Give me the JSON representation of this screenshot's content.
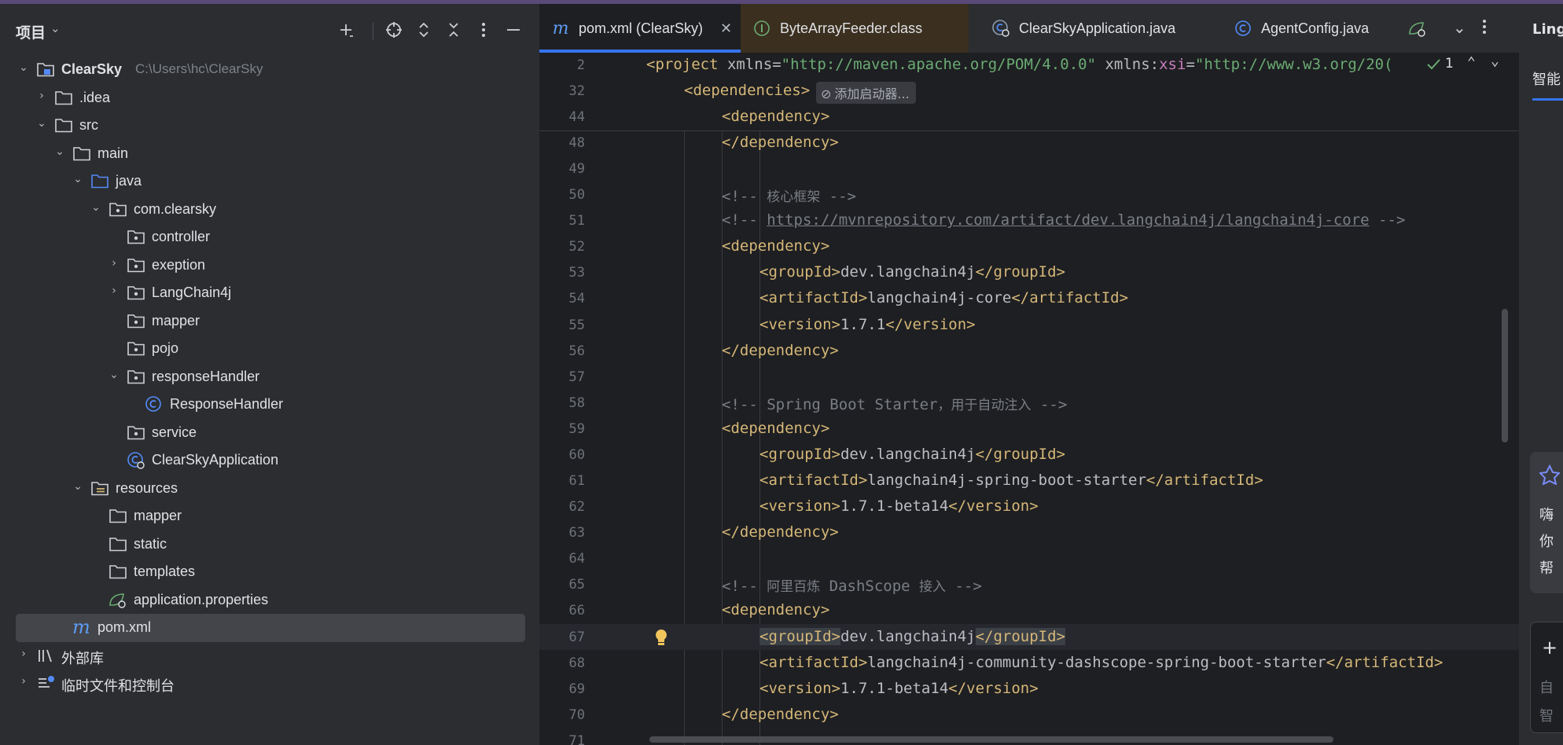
{
  "project_panel": {
    "title": "项目",
    "root_path": "C:\\Users\\hc\\ClearSky",
    "tree": [
      {
        "label": "ClearSky",
        "bold": true
      },
      {
        "label": ".idea"
      },
      {
        "label": "src"
      },
      {
        "label": "main"
      },
      {
        "label": "java"
      },
      {
        "label": "com.clearsky"
      },
      {
        "label": "controller"
      },
      {
        "label": "exeption"
      },
      {
        "label": "LangChain4j"
      },
      {
        "label": "mapper"
      },
      {
        "label": "pojo"
      },
      {
        "label": "responseHandler"
      },
      {
        "label": "ResponseHandler"
      },
      {
        "label": "service"
      },
      {
        "label": "ClearSkyApplication"
      },
      {
        "label": "resources"
      },
      {
        "label": "mapper"
      },
      {
        "label": "static"
      },
      {
        "label": "templates"
      },
      {
        "label": "application.properties"
      },
      {
        "label": "pom.xml"
      },
      {
        "label": "外部库"
      },
      {
        "label": "临时文件和控制台"
      }
    ]
  },
  "tabs": [
    {
      "label": "pom.xml (ClearSky)"
    },
    {
      "label": "ByteArrayFeeder.class"
    },
    {
      "label": "ClearSkyApplication.java"
    },
    {
      "label": "AgentConfig.java"
    }
  ],
  "editor": {
    "inspection_count": "1",
    "sticky": [
      {
        "line": "2",
        "tag": "project",
        "attr1": "xmlns",
        "val1": "\"http://maven.apache.org/POM/4.0.0\"",
        "ns": "xsi",
        "val2": "\"http://www.w3.org/20("
      },
      {
        "line": "32",
        "tag": "dependencies"
      },
      {
        "line": "44",
        "tag": "dependency"
      }
    ],
    "chip_label": "添加启动器...",
    "lines": [
      {
        "n": "48",
        "indent": 2,
        "kind": "close",
        "tag": "dependency"
      },
      {
        "n": "49",
        "indent": 0,
        "kind": "empty"
      },
      {
        "n": "50",
        "indent": 2,
        "kind": "comment",
        "text": "<!-- ",
        "cjk": "核心框架",
        "end": " -->"
      },
      {
        "n": "51",
        "indent": 2,
        "kind": "url",
        "text": "<!-- ",
        "url": "https://mvnrepository.com/artifact/dev.langchain4j/langchain4j-core",
        "end": " -->"
      },
      {
        "n": "52",
        "indent": 2,
        "kind": "open",
        "tag": "dependency"
      },
      {
        "n": "53",
        "indent": 3,
        "kind": "elem",
        "tag": "groupId",
        "value": "dev.langchain4j"
      },
      {
        "n": "54",
        "indent": 3,
        "kind": "elem",
        "tag": "artifactId",
        "value": "langchain4j-core"
      },
      {
        "n": "55",
        "indent": 3,
        "kind": "elem",
        "tag": "version",
        "value": "1.7.1"
      },
      {
        "n": "56",
        "indent": 2,
        "kind": "close",
        "tag": "dependency"
      },
      {
        "n": "57",
        "indent": 0,
        "kind": "empty"
      },
      {
        "n": "58",
        "indent": 2,
        "kind": "comment",
        "text": "<!-- Spring Boot Starter",
        "cjk": "，用于自动注入",
        "end": " -->"
      },
      {
        "n": "59",
        "indent": 2,
        "kind": "open",
        "tag": "dependency"
      },
      {
        "n": "60",
        "indent": 3,
        "kind": "elem",
        "tag": "groupId",
        "value": "dev.langchain4j"
      },
      {
        "n": "61",
        "indent": 3,
        "kind": "elem",
        "tag": "artifactId",
        "value": "langchain4j-spring-boot-starter"
      },
      {
        "n": "62",
        "indent": 3,
        "kind": "elem",
        "tag": "version",
        "value": "1.7.1-beta14"
      },
      {
        "n": "63",
        "indent": 2,
        "kind": "close",
        "tag": "dependency"
      },
      {
        "n": "64",
        "indent": 0,
        "kind": "empty"
      },
      {
        "n": "65",
        "indent": 2,
        "kind": "comment",
        "text": "<!-- ",
        "cjk": "阿里百炼",
        "mid": " DashScope ",
        "cjk2": "接入",
        "end": " -->"
      },
      {
        "n": "66",
        "indent": 2,
        "kind": "open",
        "tag": "dependency"
      },
      {
        "n": "67",
        "indent": 3,
        "kind": "elem",
        "tag": "groupId",
        "value": "dev.langchain4j",
        "current": true
      },
      {
        "n": "68",
        "indent": 3,
        "kind": "elem",
        "tag": "artifactId",
        "value": "langchain4j-community-dashscope-spring-boot-starter"
      },
      {
        "n": "69",
        "indent": 3,
        "kind": "elem",
        "tag": "version",
        "value": "1.7.1-beta14"
      },
      {
        "n": "70",
        "indent": 2,
        "kind": "close",
        "tag": "dependency"
      },
      {
        "n": "71",
        "indent": 0,
        "kind": "empty"
      }
    ]
  },
  "right_panel": {
    "title": "Ling",
    "tab": "智能",
    "card_lines": [
      "嗨",
      "你",
      "帮"
    ],
    "input_lines": [
      "自",
      "智"
    ]
  },
  "colors": {
    "accent": "#3574f0",
    "tag": "#d5b778",
    "string": "#6aab73",
    "namespace": "#c77dbb",
    "comment": "#7a7e85"
  }
}
